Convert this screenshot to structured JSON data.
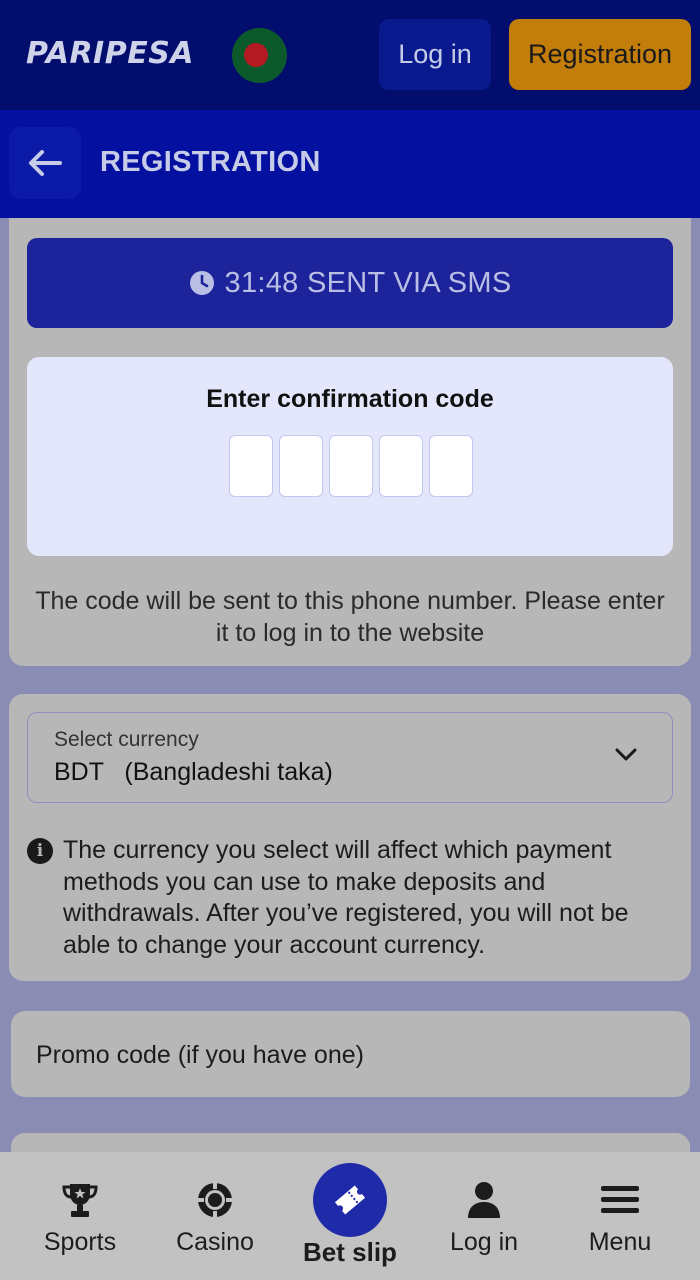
{
  "header": {
    "logo_text": "PARIPESA",
    "flag_icon": "bangladesh-flag",
    "login_label": "Log in",
    "registration_label": "Registration",
    "colors": {
      "header_bg": "#020d6e",
      "registration_button": "#c27d0a",
      "login_button": "#081a8e"
    }
  },
  "page": {
    "back_icon": "arrow-left-icon",
    "title": "REGISTRATION"
  },
  "sms": {
    "timer_icon": "clock-icon",
    "text": "31:48 SENT VIA SMS"
  },
  "confirmation": {
    "title": "Enter confirmation code",
    "digits": [
      "",
      "",
      "",
      "",
      ""
    ],
    "note": "The code will be sent to this phone number. Please enter it to log in to the website"
  },
  "currency": {
    "label": "Select currency",
    "value": "BDT   (Bangladeshi taka)",
    "dropdown_icon": "chevron-down-icon",
    "info_icon": "info-icon",
    "info_text": "The currency you select will affect which payment methods you can use to make deposits and withdrawals. After you’ve registered, you will not be able to change your account currency."
  },
  "promo": {
    "placeholder": "Promo code (if you have one)"
  },
  "bottom_nav": {
    "items": [
      {
        "label": "Sports",
        "icon": "trophy-icon"
      },
      {
        "label": "Casino",
        "icon": "casino-chip-icon"
      },
      {
        "label": "Bet slip",
        "icon": "ticket-icon"
      },
      {
        "label": "Log in",
        "icon": "user-icon"
      },
      {
        "label": "Menu",
        "icon": "hamburger-menu-icon"
      }
    ],
    "accent_color": "#1f2aa8"
  }
}
